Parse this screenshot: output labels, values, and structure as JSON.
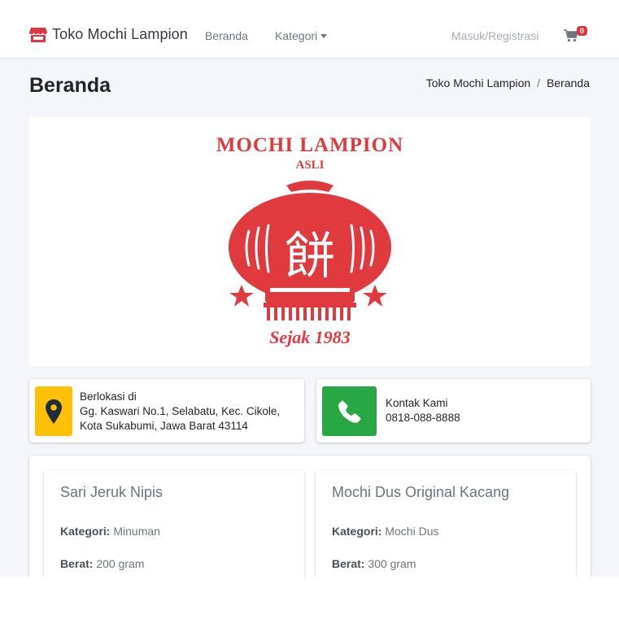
{
  "navbar": {
    "brand": "Toko Mochi Lampion",
    "home": "Beranda",
    "category": "Kategori",
    "login": "Masuk/Registrasi",
    "cart_count": "0"
  },
  "page": {
    "title": "Beranda",
    "breadcrumb": [
      "Toko Mochi Lampion",
      "/",
      "Beranda"
    ]
  },
  "hero": {
    "logo_title": "MOCHI LAMPION",
    "logo_subtitle": "ASLI",
    "logo_char": "餅",
    "logo_since": "Sejak 1983",
    "logo_color": "#e03a3e"
  },
  "location": {
    "label": "Berlokasi di",
    "line1": "Gg. Kaswari No.1, Selabatu, Kec. Cikole,",
    "line2": "Kota Sukabumi, Jawa Barat 43114",
    "icon": "map-marker-icon",
    "color": "#ffc107"
  },
  "contact": {
    "label": "Kontak Kami",
    "phone": "0818-088-8888",
    "icon": "phone-icon",
    "color": "#28a745"
  },
  "products": [
    {
      "name": "Sari Jeruk Nipis",
      "category_label": "Kategori:",
      "category": "Minuman",
      "weight_label": "Berat:",
      "weight": "200 gram"
    },
    {
      "name": "Mochi Dus Original Kacang",
      "category_label": "Kategori:",
      "category": "Mochi Dus",
      "weight_label": "Berat:",
      "weight": "300 gram"
    }
  ]
}
